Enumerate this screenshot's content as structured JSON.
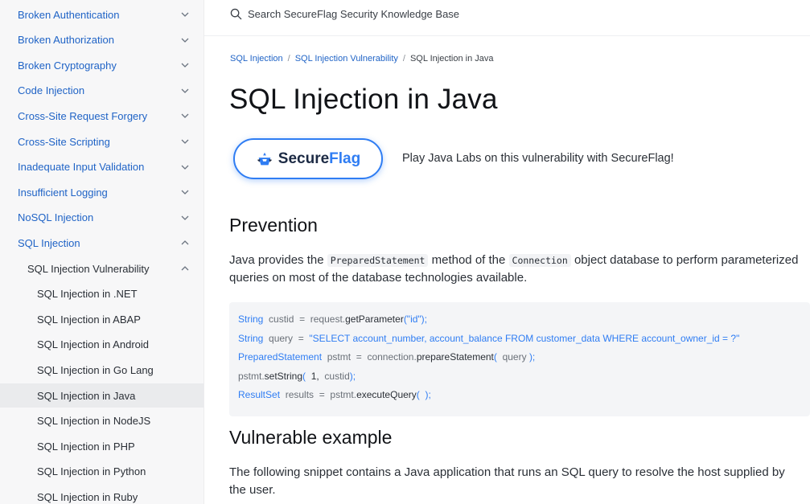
{
  "sidebar": {
    "items": [
      {
        "label": "Broken Authentication",
        "level": "top",
        "chevron": "down"
      },
      {
        "label": "Broken Authorization",
        "level": "top",
        "chevron": "down"
      },
      {
        "label": "Broken Cryptography",
        "level": "top",
        "chevron": "down"
      },
      {
        "label": "Code Injection",
        "level": "top",
        "chevron": "down"
      },
      {
        "label": "Cross-Site Request Forgery",
        "level": "top",
        "chevron": "down"
      },
      {
        "label": "Cross-Site Scripting",
        "level": "top",
        "chevron": "down"
      },
      {
        "label": "Inadequate Input Validation",
        "level": "top",
        "chevron": "down"
      },
      {
        "label": "Insufficient Logging",
        "level": "top",
        "chevron": "down"
      },
      {
        "label": "NoSQL Injection",
        "level": "top",
        "chevron": "down"
      },
      {
        "label": "SQL Injection",
        "level": "top",
        "chevron": "up"
      },
      {
        "label": "SQL Injection Vulnerability",
        "level": "sub",
        "chevron": "up"
      },
      {
        "label": "SQL Injection in .NET",
        "level": "leaf"
      },
      {
        "label": "SQL Injection in ABAP",
        "level": "leaf"
      },
      {
        "label": "SQL Injection in Android",
        "level": "leaf"
      },
      {
        "label": "SQL Injection in Go Lang",
        "level": "leaf"
      },
      {
        "label": "SQL Injection in Java",
        "level": "leaf",
        "active": true
      },
      {
        "label": "SQL Injection in NodeJS",
        "level": "leaf"
      },
      {
        "label": "SQL Injection in PHP",
        "level": "leaf"
      },
      {
        "label": "SQL Injection in Python",
        "level": "leaf"
      },
      {
        "label": "SQL Injection in Ruby",
        "level": "leaf"
      }
    ]
  },
  "search": {
    "placeholder": "Search SecureFlag Security Knowledge Base",
    "icon": "search-icon"
  },
  "breadcrumb": {
    "crumb1": "SQL Injection",
    "crumb2": "SQL Injection Vulnerability",
    "current": "SQL Injection in Java",
    "separator": "/"
  },
  "page": {
    "title": "SQL Injection in Java"
  },
  "secureflag": {
    "logo_icon": "secureflag-logo-icon",
    "word_secure": "Secure",
    "word_flag": "Flag",
    "promo_text": "Play Java Labs on this vulnerability with SecureFlag!"
  },
  "prevention": {
    "heading": "Prevention",
    "text_before": "Java provides the ",
    "code1": "PreparedStatement",
    "text_middle": " method of the ",
    "code2": "Connection",
    "text_after": " object database to perform parameterized queries on most of the database technologies available."
  },
  "code": {
    "line1": {
      "type": "String",
      "var": "custid",
      "op": "=",
      "obj": "request.",
      "method": "getParameter",
      "args": "(\"id\");"
    },
    "line2": {
      "type": "String",
      "var": "query",
      "op": "=",
      "str": "\"SELECT account_number, account_balance FROM customer_data WHERE account_owner_id = ?\""
    },
    "line3": {
      "type": "PreparedStatement",
      "var": "pstmt",
      "op": "=",
      "obj": "connection.",
      "method": "prepareStatement",
      "open": "(",
      "arg": "query",
      "close": ");"
    },
    "line4": {
      "obj": "pstmt.",
      "method": "setString",
      "open": "(",
      "num": "1,",
      "arg": "custid",
      "close": ");"
    },
    "line5": {
      "type": "ResultSet",
      "var": "results",
      "op": "=",
      "obj": "pstmt.",
      "method": "executeQuery",
      "open": "(",
      "close": ");"
    }
  },
  "vulnerable": {
    "heading": "Vulnerable example",
    "text": "The following snippet contains a Java application that runs an SQL query to resolve the host supplied by the user."
  },
  "colors": {
    "link": "#1f63c6",
    "accent": "#2f7df3",
    "sidebar_bg": "#f7f7f8",
    "active_bg": "#eaebed"
  }
}
